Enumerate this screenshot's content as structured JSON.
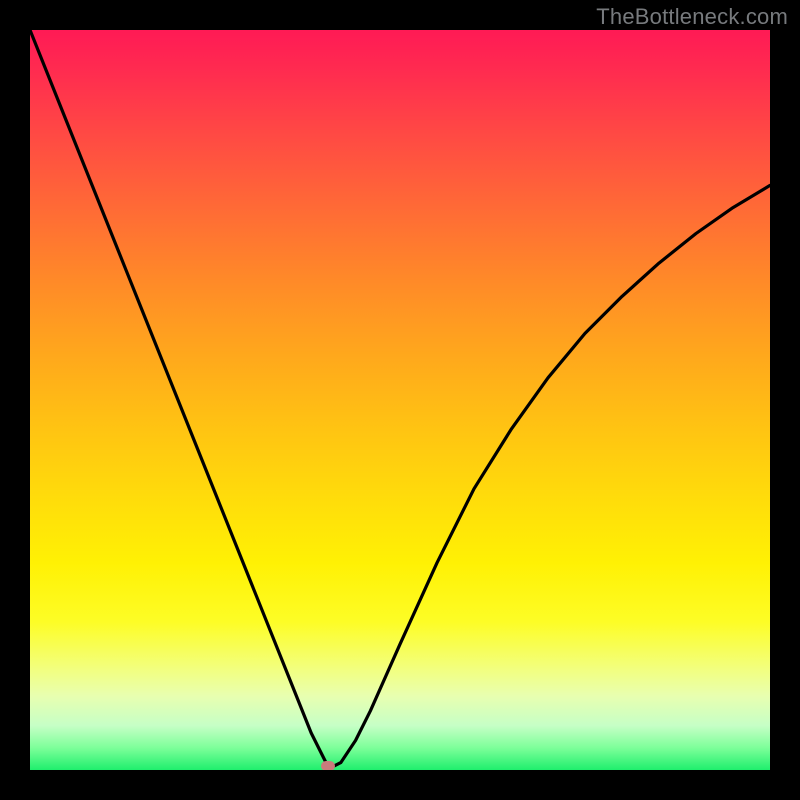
{
  "watermark": "TheBottleneck.com",
  "marker": {
    "x_fraction": 0.403,
    "y_fraction": 0.995,
    "color": "#c97c7c"
  },
  "chart_data": {
    "type": "line",
    "title": "",
    "xlabel": "",
    "ylabel": "",
    "xlim": [
      0,
      1
    ],
    "ylim": [
      0,
      1
    ],
    "annotations": [
      "TheBottleneck.com"
    ],
    "series": [
      {
        "name": "bottleneck-curve",
        "x": [
          0.0,
          0.05,
          0.1,
          0.15,
          0.2,
          0.25,
          0.3,
          0.35,
          0.38,
          0.4,
          0.41,
          0.42,
          0.44,
          0.46,
          0.5,
          0.55,
          0.6,
          0.65,
          0.7,
          0.75,
          0.8,
          0.85,
          0.9,
          0.95,
          1.0
        ],
        "y_from_top": [
          0.0,
          0.125,
          0.25,
          0.375,
          0.5,
          0.625,
          0.75,
          0.875,
          0.95,
          0.99,
          0.995,
          0.99,
          0.96,
          0.92,
          0.83,
          0.72,
          0.62,
          0.54,
          0.47,
          0.41,
          0.36,
          0.315,
          0.275,
          0.24,
          0.21
        ]
      }
    ],
    "vertex": {
      "x": 0.403,
      "y_from_top": 0.995
    }
  }
}
